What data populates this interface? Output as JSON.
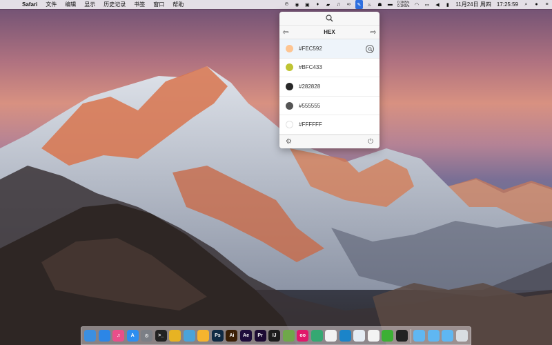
{
  "menubar": {
    "app_name": "Safari",
    "menus": [
      "文件",
      "编辑",
      "显示",
      "历史记录",
      "书签",
      "窗口",
      "帮助"
    ],
    "net_up": "0.2KB/s",
    "net_down": "0.1KB/s",
    "date": "11月24日 周四",
    "time": "17:25:59"
  },
  "picker": {
    "format": "HEX",
    "colors": [
      {
        "hex": "#FEC592",
        "swatch": "#FEC592"
      },
      {
        "hex": "#BFC433",
        "swatch": "#BFC433"
      },
      {
        "hex": "#282828",
        "swatch": "#282828"
      },
      {
        "hex": "#555555",
        "swatch": "#555555"
      },
      {
        "hex": "#FFFFFF",
        "swatch": "#FFFFFF"
      }
    ]
  },
  "dock": {
    "apps": [
      {
        "name": "finder",
        "label": "",
        "color": "#3b8fe0"
      },
      {
        "name": "safari",
        "label": "",
        "color": "#2c86e6"
      },
      {
        "name": "itunes",
        "label": "♫",
        "color": "#e84f8a"
      },
      {
        "name": "app-store",
        "label": "A",
        "color": "#2d8ef0"
      },
      {
        "name": "system-preferences",
        "label": "⚙",
        "color": "#7b7f86"
      },
      {
        "name": "terminal",
        "label": ">_",
        "color": "#222222"
      },
      {
        "name": "chrome",
        "label": "",
        "color": "#e7b323"
      },
      {
        "name": "photo-app",
        "label": "",
        "color": "#4aa3d9"
      },
      {
        "name": "sketch",
        "label": "",
        "color": "#f6b42e"
      },
      {
        "name": "photoshop",
        "label": "Ps",
        "color": "#0f2a43"
      },
      {
        "name": "illustrator",
        "label": "Ai",
        "color": "#3a1f05"
      },
      {
        "name": "after-effects",
        "label": "Ae",
        "color": "#1d0c3b"
      },
      {
        "name": "premiere",
        "label": "Pr",
        "color": "#1c0a33"
      },
      {
        "name": "intellij",
        "label": "IJ",
        "color": "#1c1c1c"
      },
      {
        "name": "android-studio",
        "label": "",
        "color": "#6fa84a"
      },
      {
        "name": "flickr",
        "label": "oo",
        "color": "#e0196b"
      },
      {
        "name": "grapher",
        "label": "",
        "color": "#35a872"
      },
      {
        "name": "photos",
        "label": "",
        "color": "#f2f2f2"
      },
      {
        "name": "screen-capture",
        "label": "",
        "color": "#1b84c9"
      },
      {
        "name": "preview",
        "label": "",
        "color": "#e4ecf4"
      },
      {
        "name": "weibo",
        "label": "",
        "color": "#f3f3f3"
      },
      {
        "name": "wechat",
        "label": "",
        "color": "#3cb034"
      },
      {
        "name": "qq",
        "label": "",
        "color": "#222222"
      }
    ],
    "folders": [
      {
        "name": "folder-applications",
        "color": "#5fb7f2"
      },
      {
        "name": "folder-documents",
        "color": "#5fb7f2"
      },
      {
        "name": "folder-downloads",
        "color": "#5fb7f2"
      },
      {
        "name": "trash",
        "color": "#d9dde2"
      }
    ]
  }
}
